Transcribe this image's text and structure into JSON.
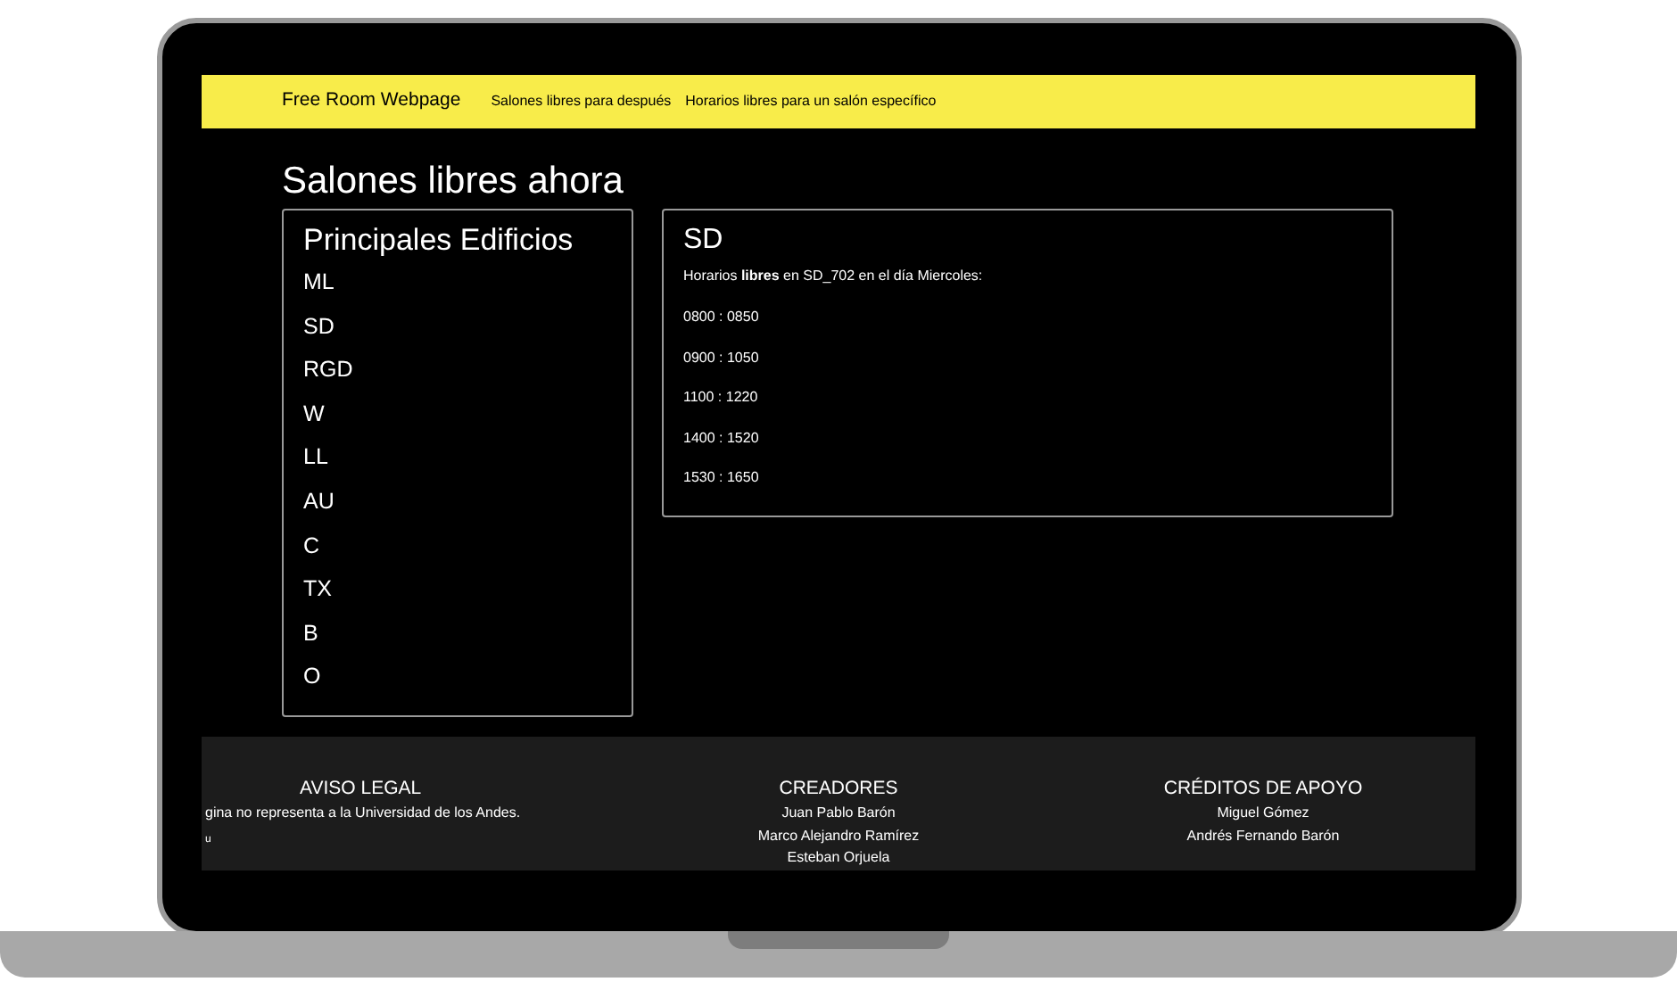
{
  "navbar": {
    "brand": "Free Room Webpage",
    "links": [
      "Salones libres para después",
      "Horarios libres para un salón específico"
    ]
  },
  "page_title": "Salones libres ahora",
  "buildings_card": {
    "title": "Principales Edificios",
    "items": [
      "ML",
      "SD",
      "RGD",
      "W",
      "LL",
      "AU",
      "C",
      "TX",
      "B",
      "O"
    ]
  },
  "schedule_card": {
    "title": "SD",
    "intro": "Horarios **libres** en SD_702 en el día Miercoles:",
    "slots": [
      "0800 : 0850",
      "0900 : 1050",
      "1100 : 1220",
      "1400 : 1520",
      "1530 : 1650"
    ]
  },
  "footer": {
    "columns": [
      {
        "heading": "AVISO LEGAL",
        "lines": [
          "gina no representa a la Universidad de los Andes.",
          "u"
        ]
      },
      {
        "heading": "CREADORES",
        "lines": [
          "Juan Pablo Barón",
          "Marco Alejandro Ramírez",
          "Esteban Orjuela"
        ]
      },
      {
        "heading": "CRÉDITOS DE APOYO",
        "lines": [
          "Miguel Gómez",
          "Andrés Fernando Barón"
        ]
      }
    ]
  }
}
